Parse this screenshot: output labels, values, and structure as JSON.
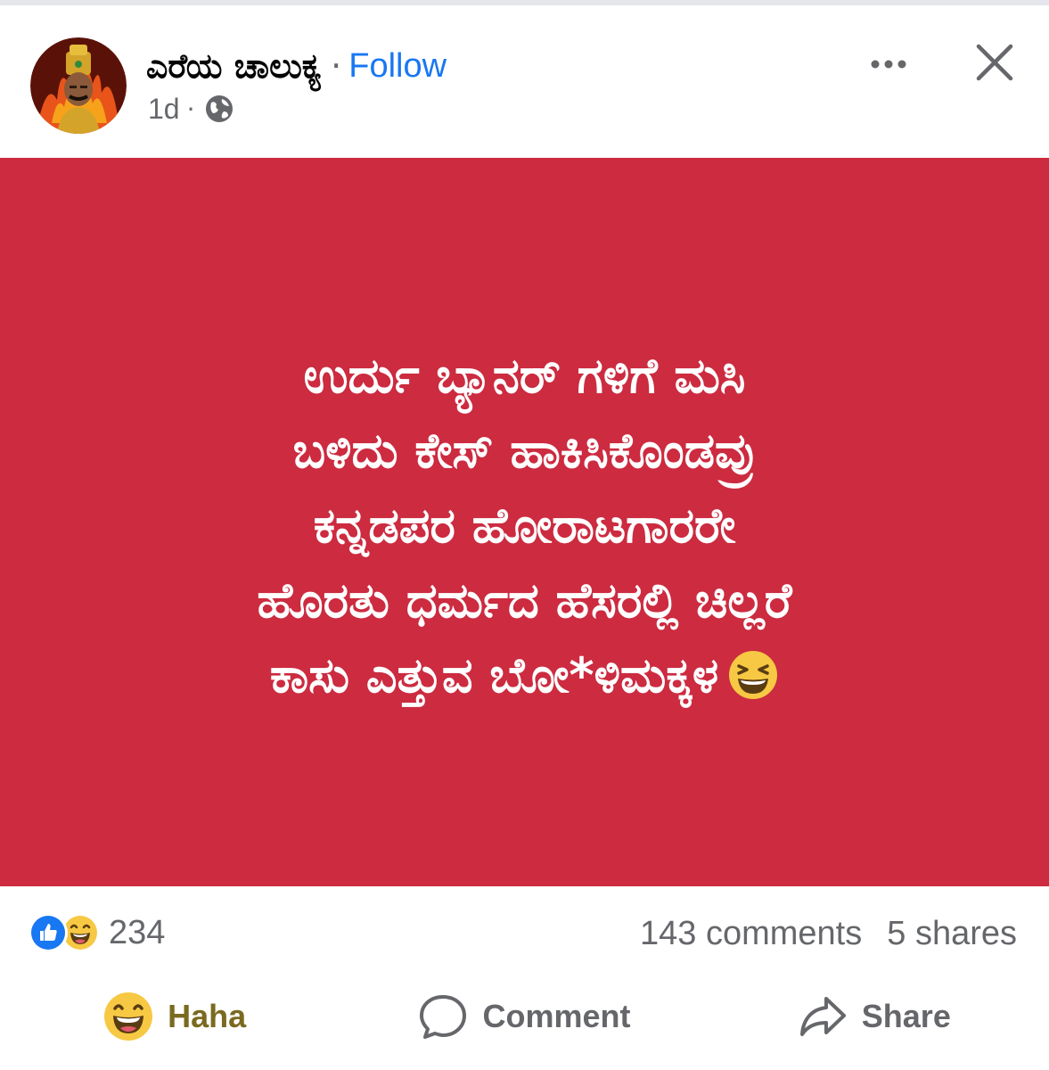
{
  "post": {
    "author": "ಎರೆಯ ಚಾಲುಕ್ಯ",
    "separator": "·",
    "follow_label": "Follow",
    "time": "1d",
    "meta_separator": "·",
    "privacy_icon": "globe-icon",
    "content_lines": [
      "ಉರ್ದು ಬ್ಯಾನರ್ ಗಳಿಗೆ ಮಸಿ",
      "ಬಳಿದು ಕೇಸ್ ಹಾಕಿಸಿಕೊಂಡವ್ರು",
      "ಕನ್ನಡಪರ ಹೋರಾಟಗಾರರೇ",
      "ಹೊರತು ಧರ್ಮದ ಹೆಸರಲ್ಲಿ ಚಿಲ್ಲರೆ",
      "ಕಾಸು ಎತ್ತುವ ಬೋ*ಳಿಮಕ್ಕಳ"
    ],
    "content_emoji": "laughing-face-icon",
    "background_color": "#cc2b40"
  },
  "stats": {
    "reaction_count": "234",
    "comments": "143 comments",
    "shares": "5 shares"
  },
  "actions": {
    "haha_label": "Haha",
    "comment_label": "Comment",
    "share_label": "Share"
  },
  "colors": {
    "accent": "#1877f2",
    "secondary_text": "#65676b",
    "haha_text": "#7a6a20"
  }
}
